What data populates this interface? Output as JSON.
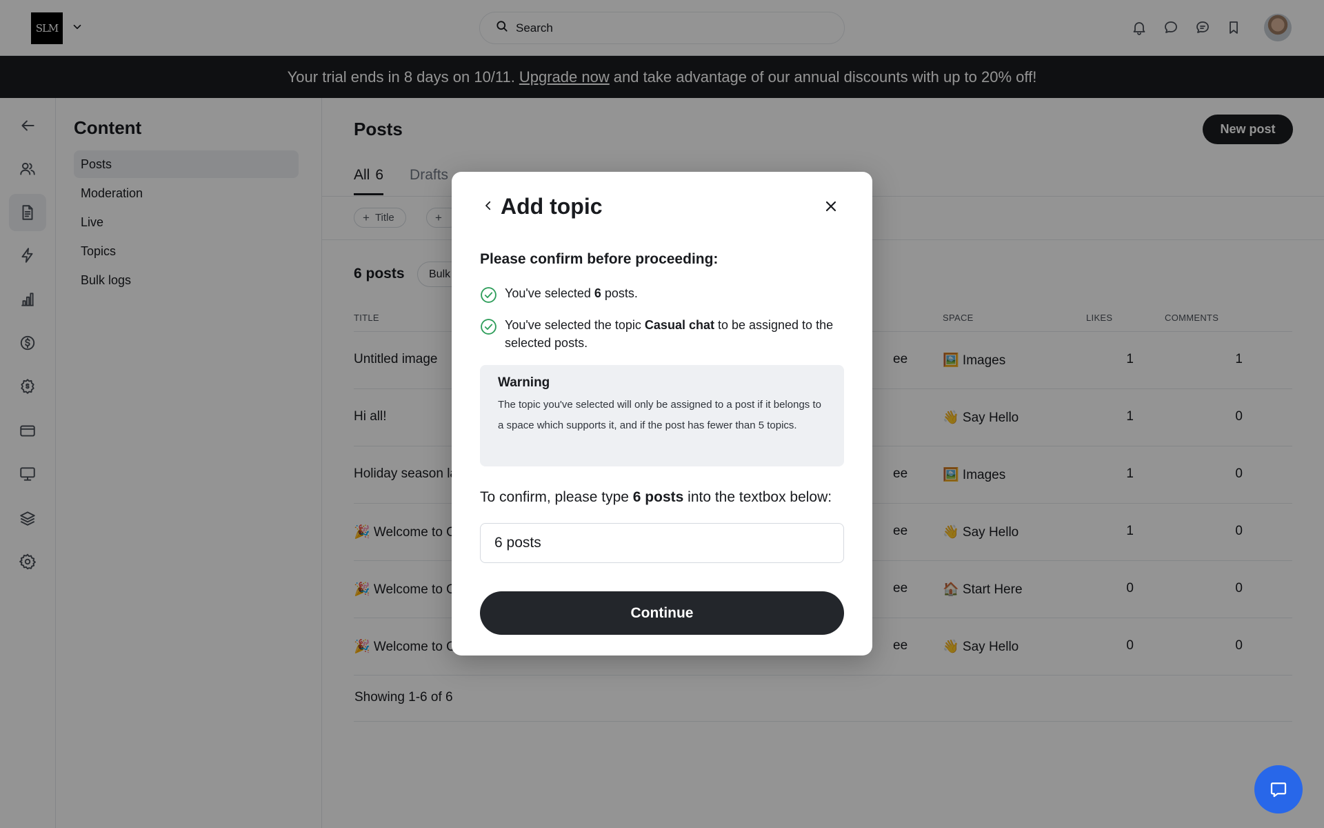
{
  "header": {
    "logo_text": "SLM",
    "search_placeholder": "Search",
    "icons": [
      "bell-icon",
      "chat-bubble-icon",
      "messages-icon",
      "bookmark-icon"
    ]
  },
  "banner": {
    "prefix": "Your trial ends in 8 days on 10/11.",
    "link": "Upgrade now",
    "suffix": "and take advantage of our annual discounts with up to 20% off!"
  },
  "rail": {
    "items": [
      "back-arrow-icon",
      "members-icon",
      "content-icon",
      "workflows-icon",
      "analytics-icon",
      "paywalls-icon",
      "affiliates-icon",
      "billing-icon",
      "site-icon",
      "plans-icon",
      "settings-icon"
    ]
  },
  "sidebar": {
    "title": "Content",
    "items": [
      {
        "label": "Posts",
        "active": true
      },
      {
        "label": "Moderation"
      },
      {
        "label": "Live"
      },
      {
        "label": "Topics"
      },
      {
        "label": "Bulk logs"
      }
    ]
  },
  "main": {
    "title": "Posts",
    "new_post": "New post",
    "tabs": [
      {
        "label": "All",
        "count": "6",
        "active": true
      },
      {
        "label": "Drafts"
      }
    ],
    "filters": [
      "Title",
      ""
    ],
    "posts_count": "6 posts",
    "bulk_label": "Bulk",
    "columns": {
      "title": "TITLE",
      "space": "SPACE",
      "likes": "LIKES",
      "comments": "COMMENTS"
    },
    "rows": [
      {
        "title": "Untitled image",
        "author": "ee",
        "space": "🖼️ Images",
        "likes": "1",
        "comments": "1"
      },
      {
        "title": "Hi all!",
        "author": "",
        "space": "👋 Say Hello",
        "likes": "1",
        "comments": "0"
      },
      {
        "title": "Holiday season la",
        "author": "ee",
        "space": "🖼️ Images",
        "likes": "1",
        "comments": "0"
      },
      {
        "title": "🎉 Welcome to O",
        "author": "ee",
        "space": "👋 Say Hello",
        "likes": "1",
        "comments": "0"
      },
      {
        "title": "🎉 Welcome to O",
        "author": "ee",
        "space": "🏠 Start Here",
        "likes": "0",
        "comments": "0"
      },
      {
        "title": "🎉 Welcome to O",
        "author": "ee",
        "space": "👋 Say Hello",
        "likes": "0",
        "comments": "0"
      }
    ],
    "showing": "Showing 1-6 of 6"
  },
  "modal": {
    "title": "Add topic",
    "heading": "Please confirm before proceeding:",
    "line1": {
      "pre": "You've selected ",
      "bold": "6",
      "post": " posts."
    },
    "line2": {
      "pre": "You've selected the topic ",
      "bold": "Casual chat",
      "post": " to be assigned to the selected posts."
    },
    "warning_title": "Warning",
    "warning_body": "The topic you've selected will only be assigned to a post if it belongs to a space which supports it, and if the post has fewer than 5 topics.",
    "type_line": {
      "pre": "To confirm, please type ",
      "bold": "6 posts",
      "post": " into the textbox below:"
    },
    "input_value": "6 posts",
    "continue": "Continue"
  },
  "colors": {
    "dark": "#1b1c1f",
    "check_green": "#2f9e5b",
    "chat_blue": "#2867e9"
  }
}
